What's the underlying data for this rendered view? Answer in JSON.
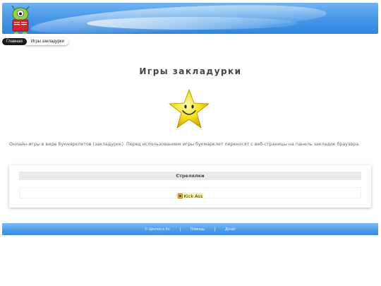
{
  "breadcrumb": {
    "home": "Главная",
    "current": "Игры закладурки"
  },
  "page": {
    "title": "Игры закладурки",
    "description": "Онлайн-игры в виде букмарклетов (закладурок). Перед использованием игры букмарклет переносят с веб-страницы на панель закладок браузера."
  },
  "section": {
    "heading": "Стрелялки",
    "games": [
      {
        "label": "Kick Ass",
        "icon": "game-icon"
      }
    ]
  },
  "footer": {
    "copyright": "© Циклоп и Ко",
    "help": "Помощь",
    "donate": "Донат"
  },
  "colors": {
    "header_blue": "#4a9ae8",
    "breadcrumb_home_bg": "#1c1c1c",
    "star_yellow": "#f5e11a",
    "link_highlight": "#fff8b8"
  }
}
